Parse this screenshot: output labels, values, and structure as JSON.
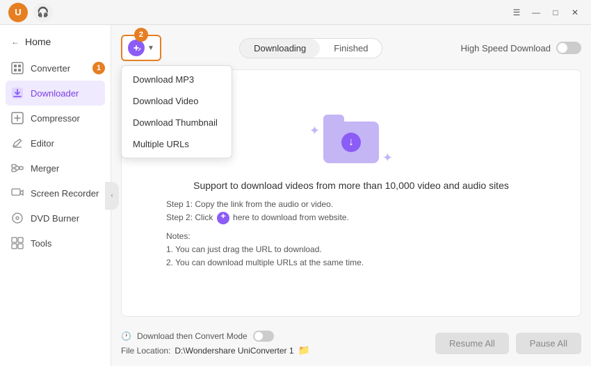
{
  "titlebar": {
    "left_icons": [
      "avatar",
      "headset"
    ],
    "controls": [
      "minimize",
      "maximize",
      "close"
    ]
  },
  "sidebar": {
    "home_label": "Home",
    "items": [
      {
        "id": "converter",
        "label": "Converter",
        "icon": "⊞",
        "active": false,
        "badge": "1"
      },
      {
        "id": "downloader",
        "label": "Downloader",
        "icon": "⬇",
        "active": true,
        "badge": null
      },
      {
        "id": "compressor",
        "label": "Compressor",
        "icon": "⊡",
        "active": false,
        "badge": null
      },
      {
        "id": "editor",
        "label": "Editor",
        "icon": "✏",
        "active": false,
        "badge": null
      },
      {
        "id": "merger",
        "label": "Merger",
        "icon": "⊞",
        "active": false,
        "badge": null
      },
      {
        "id": "screen-recorder",
        "label": "Screen Recorder",
        "icon": "⊡",
        "active": false,
        "badge": null
      },
      {
        "id": "dvd-burner",
        "label": "DVD Burner",
        "icon": "⊡",
        "active": false,
        "badge": null
      },
      {
        "id": "tools",
        "label": "Tools",
        "icon": "⊞",
        "active": false,
        "badge": null
      }
    ]
  },
  "toolbar": {
    "add_btn_badge": "2",
    "dropdown": {
      "items": [
        {
          "id": "download-mp3",
          "label": "Download MP3"
        },
        {
          "id": "download-video",
          "label": "Download Video"
        },
        {
          "id": "download-thumbnail",
          "label": "Download Thumbnail"
        },
        {
          "id": "multiple-urls",
          "label": "Multiple URLs"
        }
      ]
    },
    "tabs": [
      {
        "id": "downloading",
        "label": "Downloading",
        "active": true
      },
      {
        "id": "finished",
        "label": "Finished",
        "active": false
      }
    ],
    "speed_label": "High Speed Download"
  },
  "dropzone": {
    "title": "Support to download videos from more than 10,000 video and audio sites",
    "step1": "Step 1: Copy the link from the audio or video.",
    "step2_prefix": "Step 2: Click",
    "step2_suffix": "here to download from website.",
    "notes_label": "Notes:",
    "note1": "1. You can just drag the URL to download.",
    "note2": "2. You can download multiple URLs at the same time."
  },
  "bottom": {
    "convert_mode_label": "Download then Convert Mode",
    "file_location_label": "File Location:",
    "file_path": "D:\\Wondershare UniConverter 1",
    "resume_btn": "Resume All",
    "pause_btn": "Pause All"
  }
}
